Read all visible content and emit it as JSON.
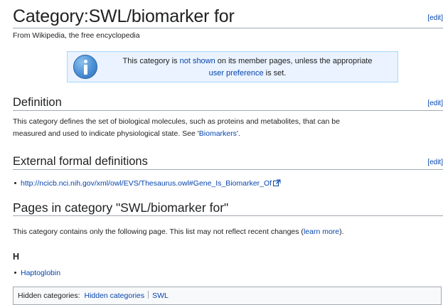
{
  "page": {
    "title": "Category:SWL/biomarker for",
    "edit_label": "[edit]",
    "tagline": "From Wikipedia, the free encyclopedia"
  },
  "notice": {
    "text_before": "This category is ",
    "link1": "not shown",
    "text_middle": " on its member pages, unless the appropriate",
    "link2": "user preference",
    "text_after": " is set."
  },
  "definition": {
    "heading": "Definition",
    "edit_label": "[edit]",
    "text_line1": "This category defines the set of biological molecules, such as proteins and metabolites, that can be",
    "text_line2_before": "measured and used to indicate physiological state. See '",
    "link": "Biomarkers",
    "text_line2_after": "'."
  },
  "external": {
    "heading": "External formal definitions",
    "edit_label": "[edit]",
    "link": "http://ncicb.nci.nih.gov/xml/owl/EVS/Thesaurus.owl#Gene_Is_Biomarker_Of"
  },
  "pages_section": {
    "heading": "Pages in category \"SWL/biomarker for\"",
    "text_before": "This category contains only the following page. This list may not reflect recent changes (",
    "link": "learn more",
    "text_after": ")."
  },
  "index": {
    "letter": "H",
    "items": [
      {
        "label": "Haptoglobin"
      }
    ]
  },
  "hidden_categories": {
    "label": "Hidden categories:",
    "items": [
      {
        "label": "Hidden categories"
      },
      {
        "label": "SWL"
      }
    ]
  }
}
